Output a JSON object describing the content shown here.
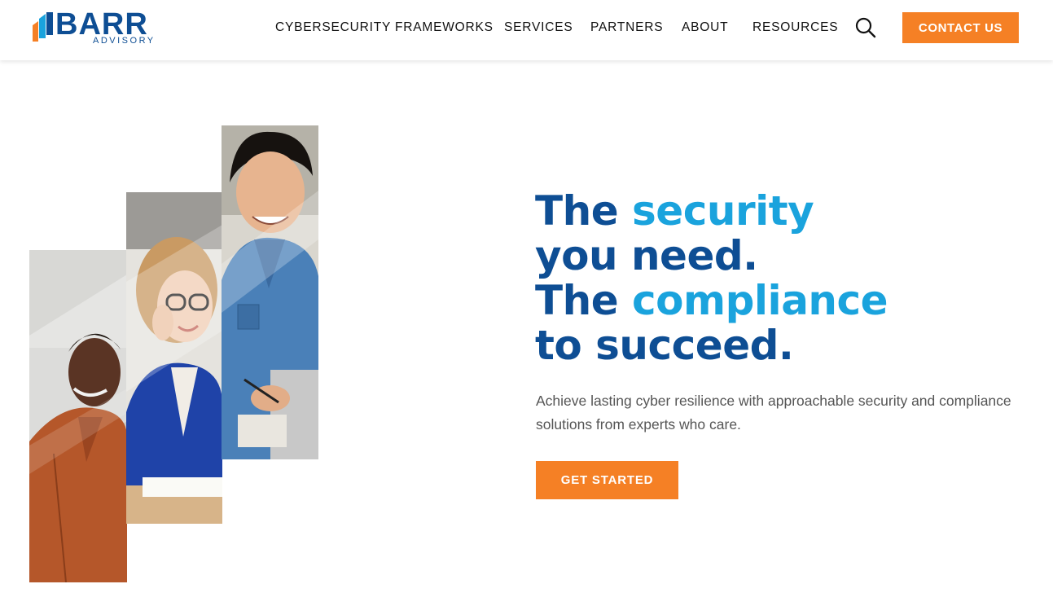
{
  "brand": {
    "name": "BARR",
    "tagline": "ADVISORY",
    "primary_color": "#0e4e94",
    "accent_color": "#1aa3dd",
    "cta_color": "#f58025"
  },
  "nav": {
    "items": [
      {
        "label": "CYBERSECURITY FRAMEWORKS"
      },
      {
        "label": "SERVICES"
      },
      {
        "label": "PARTNERS"
      },
      {
        "label": "ABOUT"
      },
      {
        "label": "RESOURCES"
      }
    ],
    "search_icon": "search-icon",
    "contact_label": "CONTACT US"
  },
  "hero": {
    "line1_a": "The ",
    "line1_b": "security",
    "line2": "you need.",
    "line3_a": "The ",
    "line3_b": "compliance",
    "line4": "to succeed.",
    "description": "Achieve lasting cyber resilience with approachable security and compliance solutions from experts who care.",
    "cta_label": "GET STARTED"
  }
}
